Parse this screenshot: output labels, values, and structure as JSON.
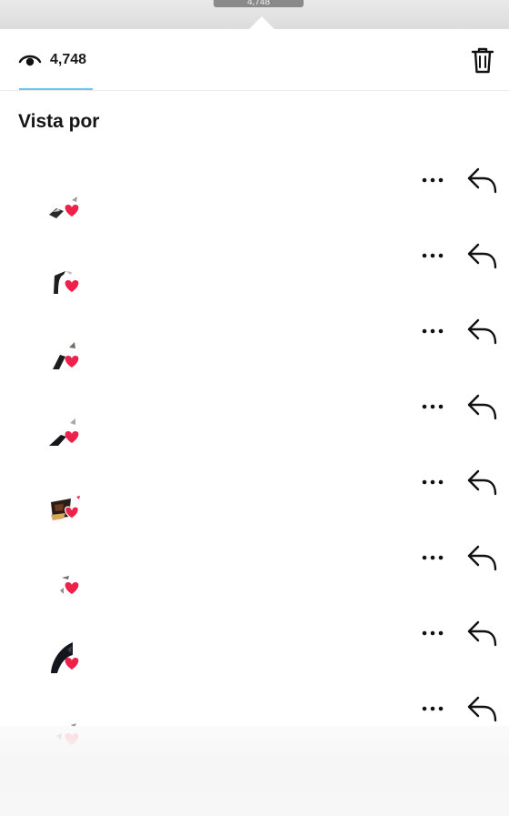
{
  "top_bar": {
    "tab_text": "4,748"
  },
  "header": {
    "view_count": "4,748",
    "eye_icon": "eye-icon",
    "delete_icon": "trash-icon"
  },
  "section": {
    "title": "Vista por"
  },
  "colors": {
    "heart": "#ed2149",
    "tab_underline": "#5ec8f2",
    "icon": "#111111"
  },
  "viewers": [
    {
      "avatar": "avatar-1",
      "liked": true,
      "more_icon": "more-horizontal-icon",
      "reply_icon": "reply-arrow-icon"
    },
    {
      "avatar": "avatar-2",
      "liked": true,
      "more_icon": "more-horizontal-icon",
      "reply_icon": "reply-arrow-icon"
    },
    {
      "avatar": "avatar-3",
      "liked": true,
      "more_icon": "more-horizontal-icon",
      "reply_icon": "reply-arrow-icon"
    },
    {
      "avatar": "avatar-4",
      "liked": true,
      "more_icon": "more-horizontal-icon",
      "reply_icon": "reply-arrow-icon"
    },
    {
      "avatar": "avatar-5",
      "liked": true,
      "more_icon": "more-horizontal-icon",
      "reply_icon": "reply-arrow-icon"
    },
    {
      "avatar": "avatar-6",
      "liked": true,
      "more_icon": "more-horizontal-icon",
      "reply_icon": "reply-arrow-icon"
    },
    {
      "avatar": "avatar-7",
      "liked": true,
      "more_icon": "more-horizontal-icon",
      "reply_icon": "reply-arrow-icon"
    },
    {
      "avatar": "avatar-8",
      "liked": true,
      "more_icon": "more-horizontal-icon",
      "reply_icon": "reply-arrow-icon"
    }
  ]
}
